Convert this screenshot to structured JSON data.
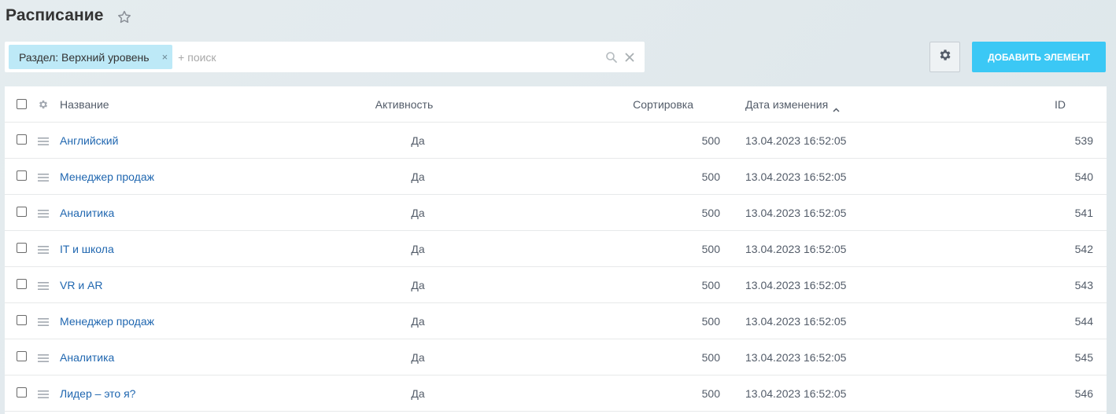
{
  "page": {
    "title": "Расписание"
  },
  "filter": {
    "chip_label": "Раздел: Верхний уровень",
    "chip_close": "×",
    "search_placeholder": "+ поиск"
  },
  "toolbar": {
    "add_label": "ДОБАВИТЬ ЭЛЕМЕНТ"
  },
  "columns": {
    "name": "Название",
    "active": "Активность",
    "sort": "Сортировка",
    "date": "Дата изменения",
    "id": "ID"
  },
  "rows": [
    {
      "name": "Английский",
      "active": "Да",
      "sort": "500",
      "date": "13.04.2023 16:52:05",
      "id": "539"
    },
    {
      "name": "Менеджер продаж",
      "active": "Да",
      "sort": "500",
      "date": "13.04.2023 16:52:05",
      "id": "540"
    },
    {
      "name": "Аналитика",
      "active": "Да",
      "sort": "500",
      "date": "13.04.2023 16:52:05",
      "id": "541"
    },
    {
      "name": "IT и школа",
      "active": "Да",
      "sort": "500",
      "date": "13.04.2023 16:52:05",
      "id": "542"
    },
    {
      "name": "VR и AR",
      "active": "Да",
      "sort": "500",
      "date": "13.04.2023 16:52:05",
      "id": "543"
    },
    {
      "name": "Менеджер продаж",
      "active": "Да",
      "sort": "500",
      "date": "13.04.2023 16:52:05",
      "id": "544"
    },
    {
      "name": "Аналитика",
      "active": "Да",
      "sort": "500",
      "date": "13.04.2023 16:52:05",
      "id": "545"
    },
    {
      "name": "Лидер – это я?",
      "active": "Да",
      "sort": "500",
      "date": "13.04.2023 16:52:05",
      "id": "546"
    }
  ],
  "colors": {
    "accent": "#3bc8f5",
    "link": "#2067b0",
    "chip": "#bde9f7"
  }
}
